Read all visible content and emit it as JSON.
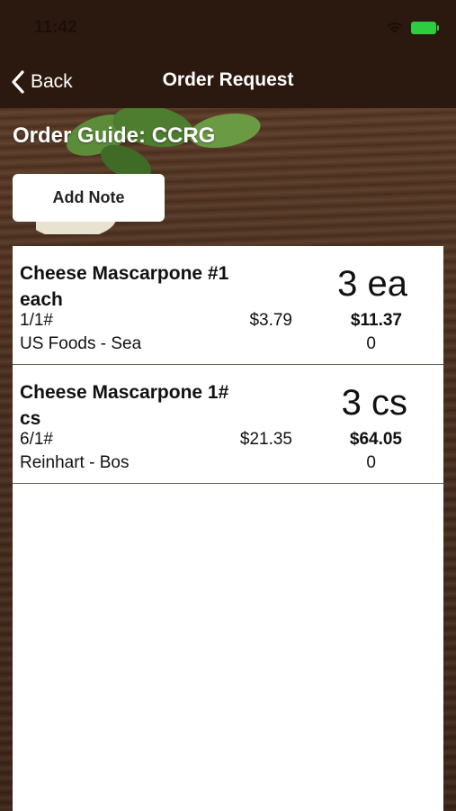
{
  "status": {
    "time": "11:42"
  },
  "nav": {
    "back_label": "Back",
    "title": "Order Request"
  },
  "guide": {
    "title": "Order Guide: CCRG"
  },
  "actions": {
    "add_note_label": "Add Note"
  },
  "orders": [
    {
      "name": "Cheese Mascarpone #1 each",
      "quantity": "3 ea",
      "pack": "1/1#",
      "price": "$3.79",
      "total": "$11.37",
      "vendor": "US Foods - Sea",
      "count": "0"
    },
    {
      "name": "Cheese Mascarpone 1# cs",
      "quantity": "3 cs",
      "pack": "6/1#",
      "price": "$21.35",
      "total": "$64.05",
      "vendor": "Reinhart - Bos",
      "count": "0"
    }
  ],
  "colors": {
    "nav_bg": "#2b1910",
    "battery": "#2ecc40",
    "row_divider": "#5e6e4e"
  }
}
